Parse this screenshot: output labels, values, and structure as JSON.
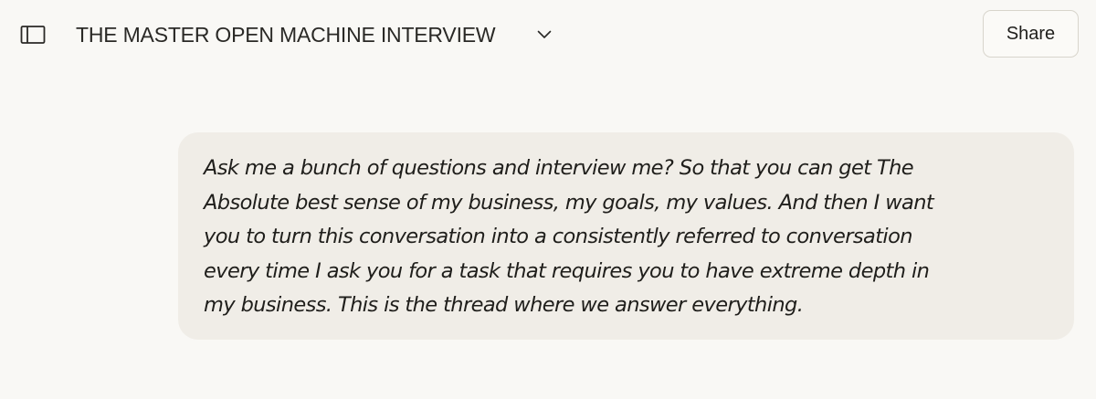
{
  "header": {
    "sidebar_icon": "sidebar-icon",
    "title": "THE MASTER OPEN MACHINE INTERVIEW",
    "title_dropdown_icon": "chevron-down-icon",
    "share_label": "Share"
  },
  "conversation": {
    "messages": [
      {
        "role": "user",
        "lines": [
          "Ask me a bunch of questions and interview me? So that you can get The",
          "Absolute best sense of my business, my goals, my values. And then I want",
          "you to turn this conversation into a consistently referred to conversation",
          "every time I ask you for a task that requires you to have extreme depth in",
          "my business. This is the thread where we answer everything."
        ]
      }
    ]
  },
  "colors": {
    "background": "#f9f8f5",
    "bubble": "#f0ede7",
    "text": "#1f1e1b",
    "border": "#d8d5cc"
  }
}
